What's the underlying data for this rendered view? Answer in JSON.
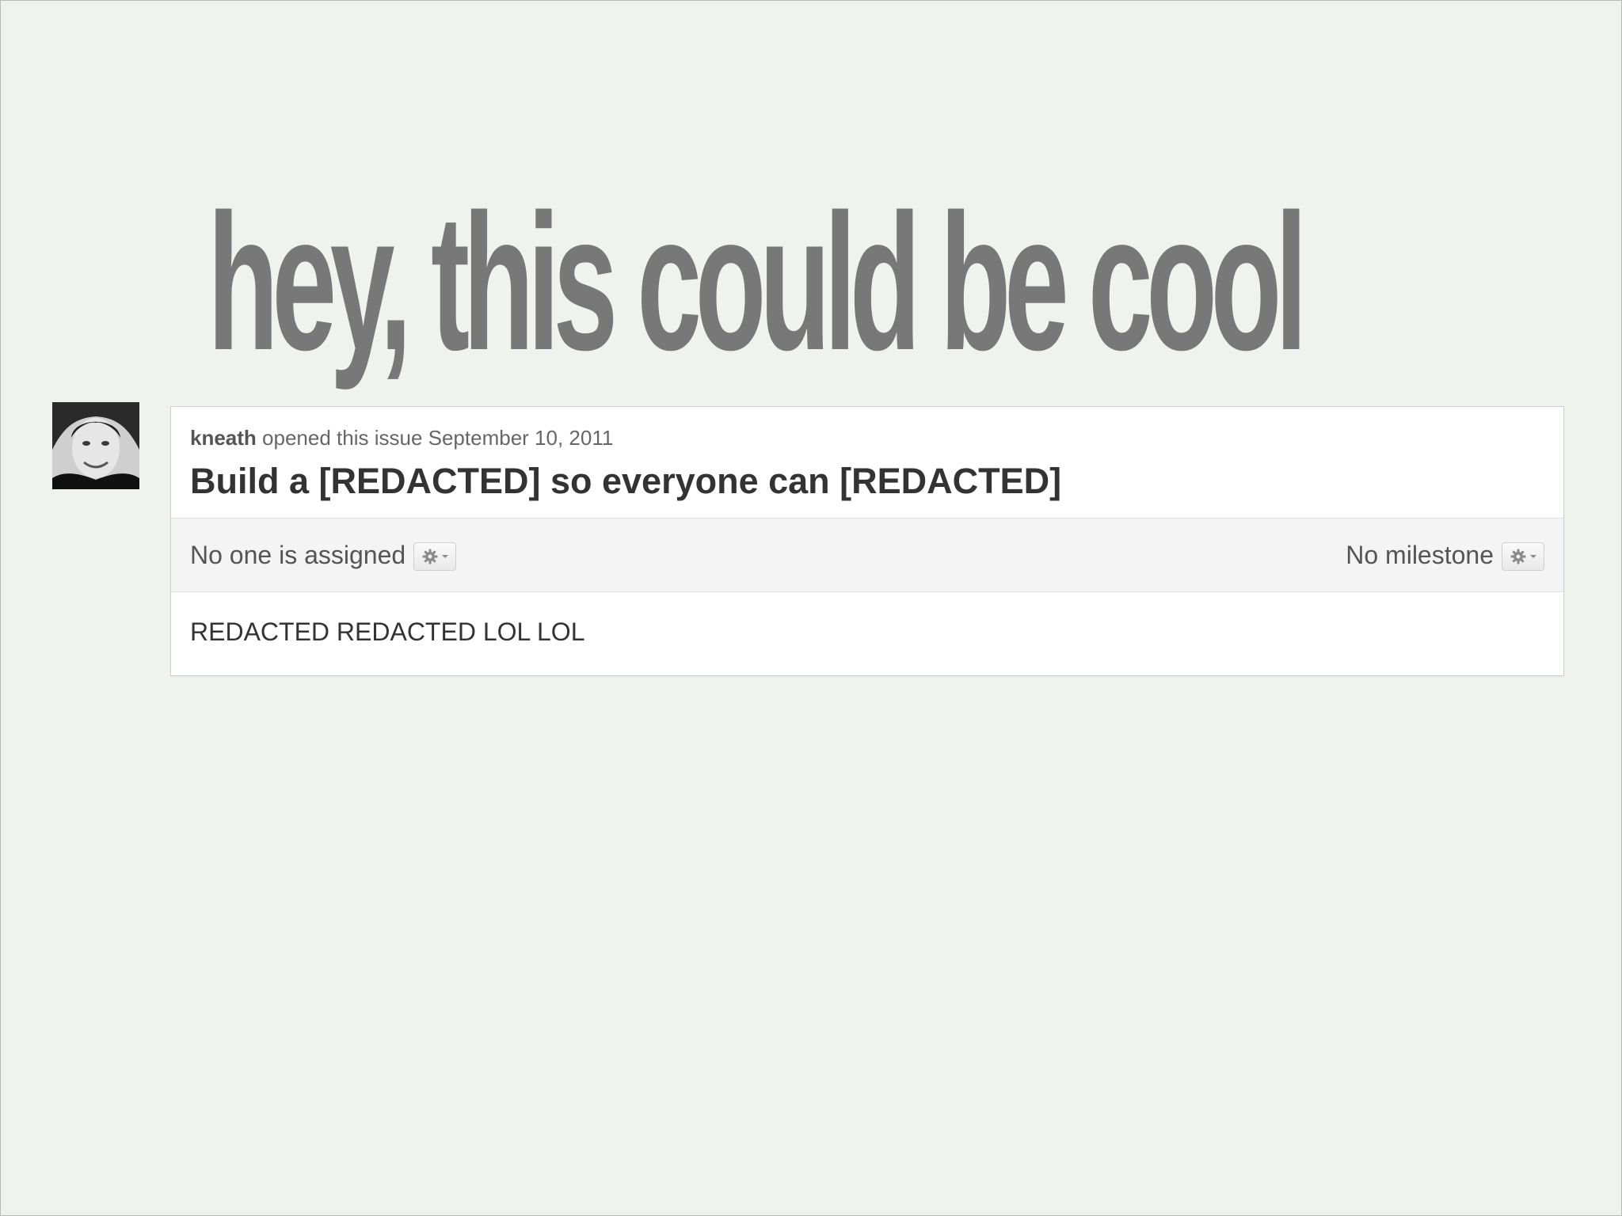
{
  "slide": {
    "headline": "hey, this could be cool"
  },
  "issue": {
    "author": "kneath",
    "opened_text": "opened this issue September 10, 2011",
    "title": "Build a [REDACTED] so everyone can [REDACTED]",
    "assignee_text": "No one is assigned",
    "milestone_text": "No milestone",
    "body": "REDACTED REDACTED LOL LOL"
  },
  "icons": {
    "avatar": "user-avatar",
    "assignee_button": "gear-icon",
    "milestone_button": "gear-icon"
  },
  "colors": {
    "background": "#f0f2ee",
    "headline": "#787878",
    "card": "#ffffff",
    "bar": "#f4f4f4"
  }
}
